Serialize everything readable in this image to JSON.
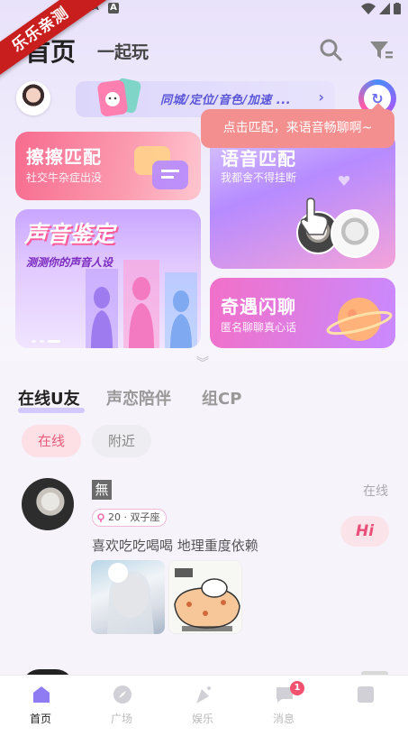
{
  "watermark": "乐乐亲测",
  "statusbar": {
    "icon_a1": "A",
    "icon_a2": "A"
  },
  "header": {
    "tab_active": "首页",
    "tab_inactive": "一起玩"
  },
  "banner": {
    "text": "同城/定位/音色/加速 ...",
    "chevron": "›"
  },
  "tooltip": "点击匹配，来语音畅聊啊~",
  "cards": {
    "swipe_match": {
      "title": "擦擦匹配",
      "subtitle": "社交牛杂症出没"
    },
    "voice_match": {
      "title": "语音匹配",
      "subtitle": "我都舍不得挂断"
    },
    "voice_test": {
      "title": "声音鉴定",
      "subtitle": "测测你的声音人设"
    },
    "flash_chat": {
      "title": "奇遇闪聊",
      "subtitle": "匿名聊聊真心话"
    }
  },
  "tabs": [
    "在线U友",
    "声恋陪伴",
    "组CP"
  ],
  "chips": [
    "在线",
    "附近"
  ],
  "user": {
    "name": "無",
    "status": "在线",
    "tag": "20 · 双子座",
    "bio": "喜欢吃吃喝喝 地理重度依赖",
    "hi": "Hi"
  },
  "nav": [
    {
      "label": "首页",
      "icon": "home-icon"
    },
    {
      "label": "广场",
      "icon": "compass-icon"
    },
    {
      "label": "娱乐",
      "icon": "party-icon"
    },
    {
      "label": "消息",
      "icon": "message-icon",
      "badge": "1"
    },
    {
      "label": "",
      "icon": "profile-icon"
    }
  ],
  "colors": {
    "accent": "#f76b8f",
    "purple": "#b68bff",
    "hi": "#ea4f79"
  }
}
